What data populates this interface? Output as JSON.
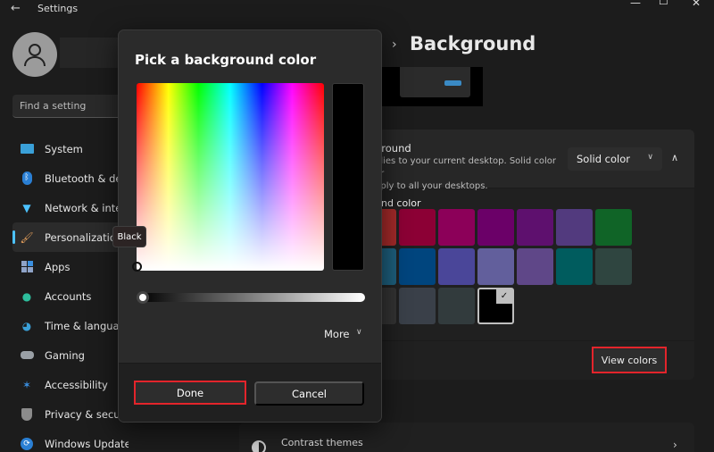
{
  "window": {
    "title": "Settings",
    "controls": [
      "minimize",
      "maximize",
      "close"
    ]
  },
  "sidebar": {
    "search_placeholder": "Find a setting",
    "items": [
      {
        "label": "System",
        "icon": "monitor-icon",
        "color": "#3aa0d8",
        "active": false
      },
      {
        "label": "Bluetooth & devices",
        "icon": "bluetooth-icon",
        "color": "#2a7fd4",
        "active": false
      },
      {
        "label": "Network & internet",
        "icon": "wifi-icon",
        "color": "#4cc2ff",
        "active": false
      },
      {
        "label": "Personalization",
        "icon": "brush-icon",
        "color": "#e8a15c",
        "active": true
      },
      {
        "label": "Apps",
        "icon": "apps-icon",
        "color": "#8fa3c7",
        "active": false
      },
      {
        "label": "Accounts",
        "icon": "person-icon",
        "color": "#2dbd9c",
        "active": false
      },
      {
        "label": "Time & language",
        "icon": "globe-clock-icon",
        "color": "#3aa0d8",
        "active": false
      },
      {
        "label": "Gaming",
        "icon": "gamepad-icon",
        "color": "#9aa0a6",
        "active": false
      },
      {
        "label": "Accessibility",
        "icon": "accessibility-icon",
        "color": "#3a8fe0",
        "active": false
      },
      {
        "label": "Privacy & security",
        "icon": "shield-icon",
        "color": "#8b8b8b",
        "active": false
      },
      {
        "label": "Windows Update",
        "icon": "update-icon",
        "color": "#2a7fd4",
        "active": false
      }
    ]
  },
  "page": {
    "breadcrumb_separator": "›",
    "title": "Background",
    "background_setting": {
      "title": "Personalize your background",
      "desc_line1": "Picture background applies to your current desktop. Solid color or",
      "desc_line2": "slideshow apply to all your desktops.",
      "visible_title": "ground",
      "visible_desc1": "plies to your current desktop. Solid color or",
      "visible_desc2": "pply to all your desktops.",
      "select_value": "Solid color"
    },
    "color_label": "und color",
    "swatches": [
      [
        "#a52a2a",
        "#8c0035",
        "#8c0059",
        "#6b0068",
        "#5e106e",
        "#523a7e",
        "#106427"
      ],
      [
        "#1d5f7d",
        "#00457e",
        "#4a4699",
        "#625f9c",
        "#5f4788",
        "#005c5e",
        "#2f4540"
      ],
      [
        "#333333",
        "#3a4049",
        "#323b3d",
        "#000000"
      ]
    ],
    "selected_swatch": "#000000",
    "custom_colors_button": "View colors",
    "contrast_themes_label": "Contrast themes"
  },
  "dialog": {
    "title": "Pick a background color",
    "selected_color_name": "Black",
    "selected_color": "#000000",
    "brightness_value": 0,
    "more_label": "More",
    "done_label": "Done",
    "cancel_label": "Cancel"
  },
  "highlight_color": "#e3242b"
}
